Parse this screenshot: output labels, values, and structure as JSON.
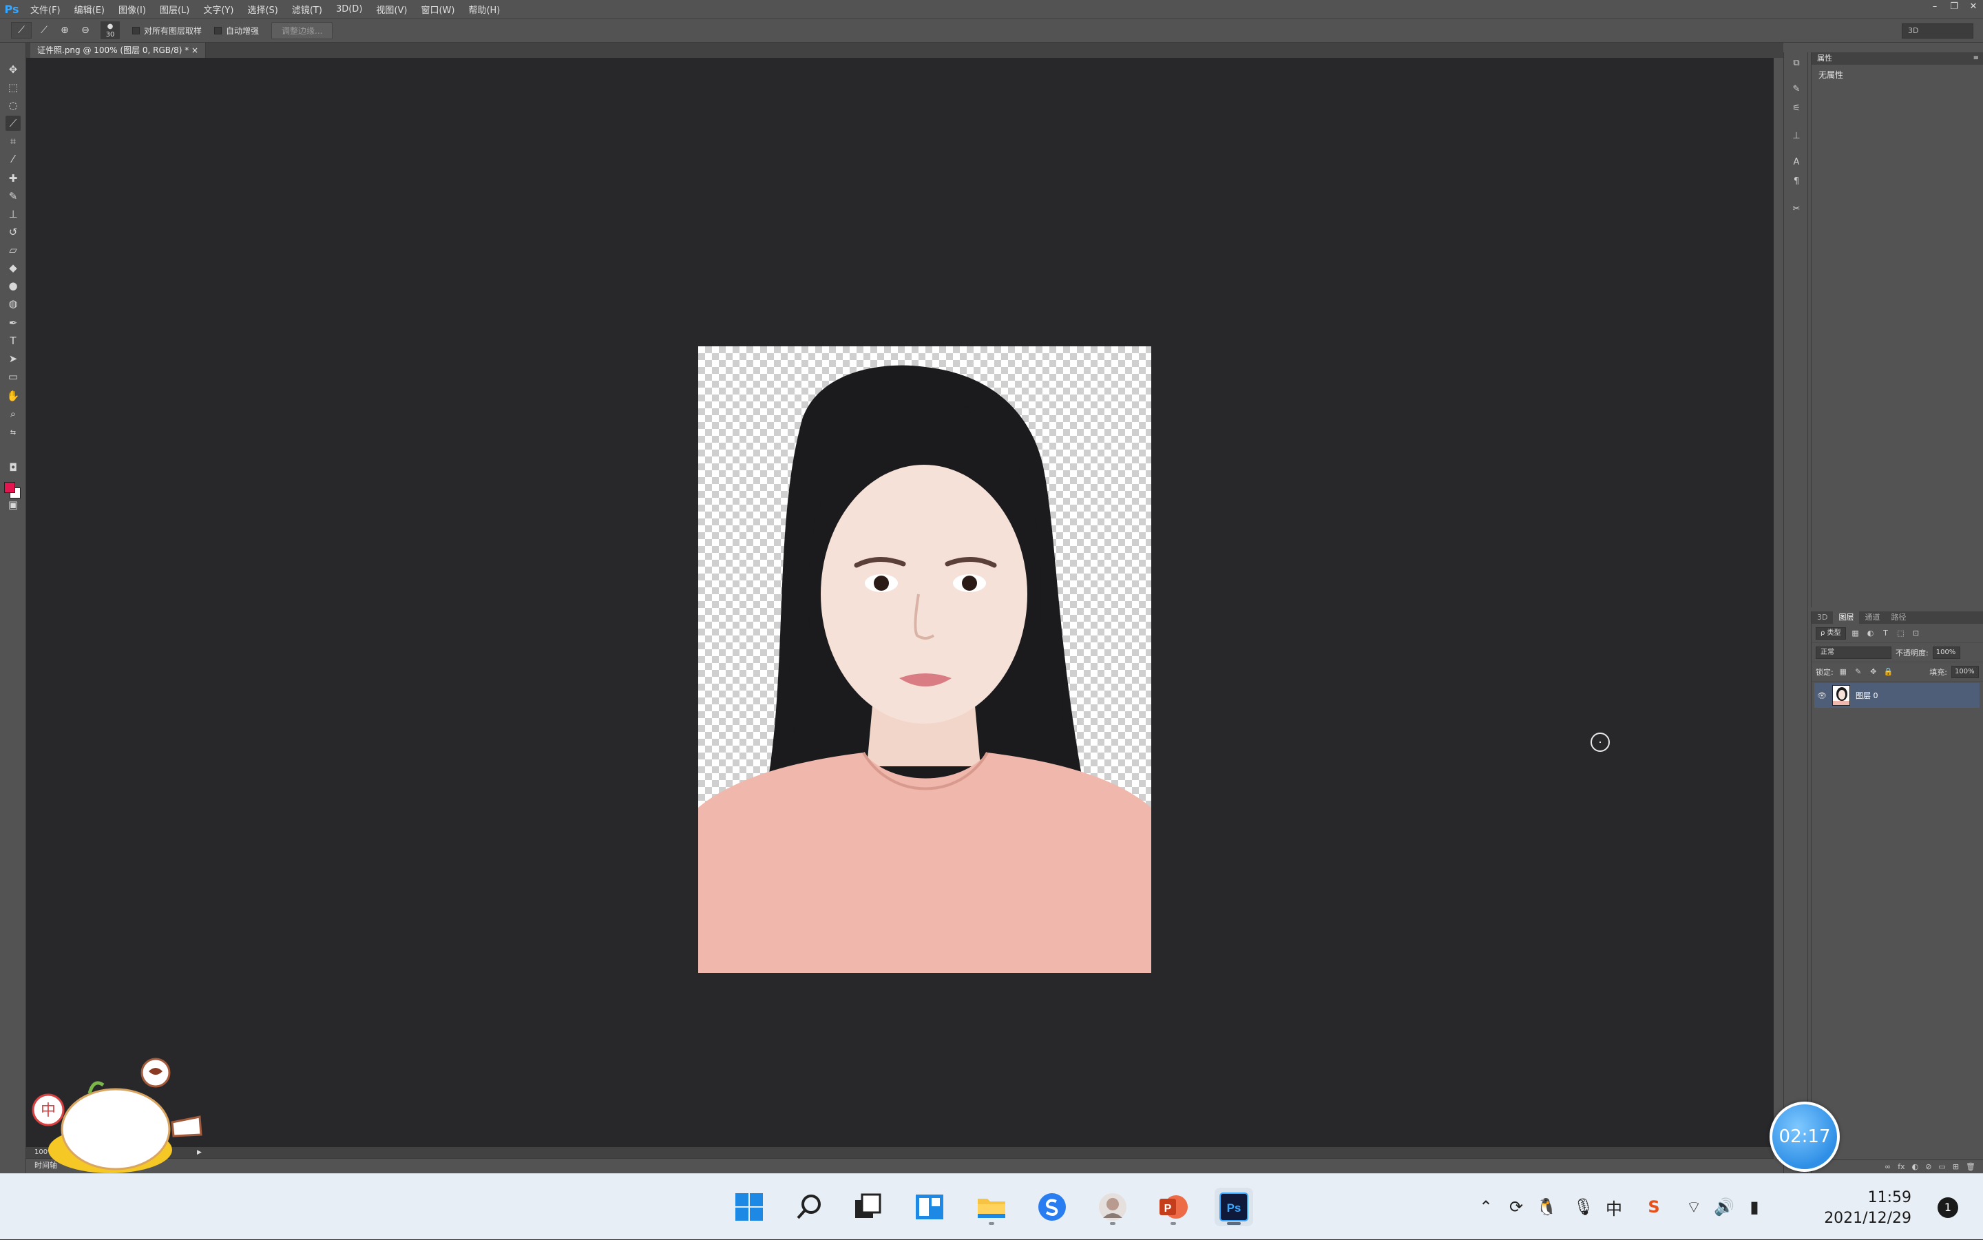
{
  "menubar": {
    "logo": "Ps",
    "items": [
      "文件(F)",
      "编辑(E)",
      "图像(I)",
      "图层(L)",
      "文字(Y)",
      "选择(S)",
      "滤镜(T)",
      "3D(D)",
      "视图(V)",
      "窗口(W)",
      "帮助(H)"
    ],
    "window_controls": [
      "–",
      "❐",
      "✕"
    ]
  },
  "options": {
    "tool_glyph": "⟋",
    "brush_size": "30",
    "sample_all_layers": "对所有图层取样",
    "auto_enhance": "自动增强",
    "refine_edge": "调整边缘...",
    "workspace": "3D"
  },
  "document": {
    "tab_title": "证件照.png @ 100% (图层 0, RGB/8) *",
    "zoom": "100%",
    "timeline_label": "时间轴"
  },
  "colors": {
    "foreground": "#e3174f",
    "background": "#ffffff",
    "accent": "#3aa7ff",
    "selected_layer": "#4e5e78"
  },
  "properties": {
    "title": "属性",
    "body": "无属性"
  },
  "layers": {
    "tabs": [
      "3D",
      "图层",
      "通道",
      "路径"
    ],
    "kind_filter": "ρ 类型",
    "blend_mode": "正常",
    "opacity_label": "不透明度:",
    "opacity_value": "100%",
    "lock_label": "锁定:",
    "fill_label": "填充:",
    "fill_value": "100%",
    "layer_name": "图层 0",
    "footer_icons": [
      "∞",
      "fx",
      "◐",
      "⊘",
      "▭",
      "⊞",
      "🗑"
    ]
  },
  "timer": {
    "text": "02:17"
  },
  "sticker": {
    "char": "中"
  },
  "taskbar": {
    "time": "11:59",
    "date": "2021/12/29",
    "notifications": "1",
    "ime": "中",
    "apps": [
      "start",
      "search",
      "task-view",
      "widgets",
      "file-explorer",
      "sogou",
      "avatar-app",
      "powerpoint",
      "photoshop"
    ]
  }
}
